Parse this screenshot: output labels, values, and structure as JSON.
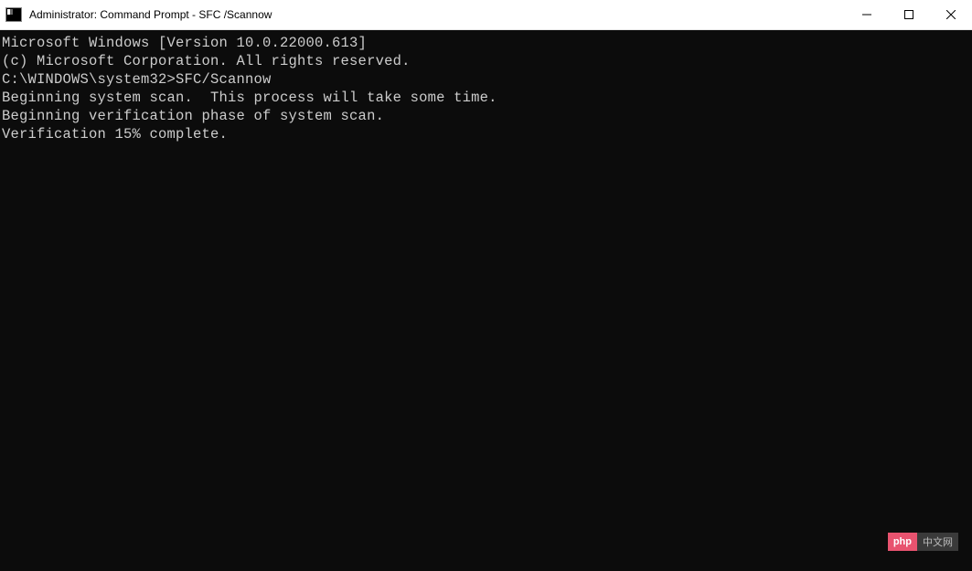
{
  "window": {
    "title": "Administrator: Command Prompt - SFC /Scannow"
  },
  "terminal": {
    "line1": "Microsoft Windows [Version 10.0.22000.613]",
    "line2": "(c) Microsoft Corporation. All rights reserved.",
    "blank1": "",
    "promptLine": "C:\\WINDOWS\\system32>SFC/Scannow",
    "blank2": "",
    "line3": "Beginning system scan.  This process will take some time.",
    "blank3": "",
    "line4": "Beginning verification phase of system scan.",
    "line5": "Verification 15% complete."
  },
  "watermark": {
    "left": "php",
    "right": "中文网"
  }
}
